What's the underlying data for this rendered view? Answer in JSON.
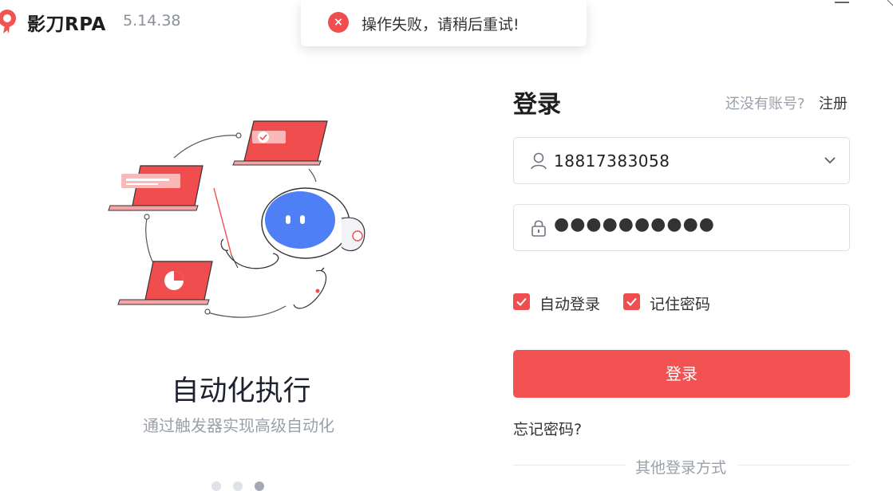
{
  "app": {
    "name": "影刀RPA",
    "version": "5.14.38",
    "logo_icon": "yingdao-logo-icon",
    "accent_color": "#f25252"
  },
  "toast": {
    "type": "error",
    "icon": "error-x-icon",
    "message": "操作失败，请稍后重试!"
  },
  "carousel": {
    "title": "自动化执行",
    "subtitle": "通过触发器实现高级自动化",
    "slide_count": 3,
    "active_index": 2
  },
  "login": {
    "title": "登录",
    "no_account_text": "还没有账号?",
    "register_link": "注册",
    "username": {
      "icon": "user-icon",
      "value": "18817383058",
      "dropdown_icon": "chevron-down-icon"
    },
    "password": {
      "icon": "lock-icon",
      "value": "●●●●●●●●●●"
    },
    "auto_login": {
      "label": "自动登录",
      "checked": true
    },
    "remember_password": {
      "label": "记住密码",
      "checked": true
    },
    "submit_label": "登录",
    "forgot_password": "忘记密码?",
    "other_methods": "其他登录方式"
  }
}
